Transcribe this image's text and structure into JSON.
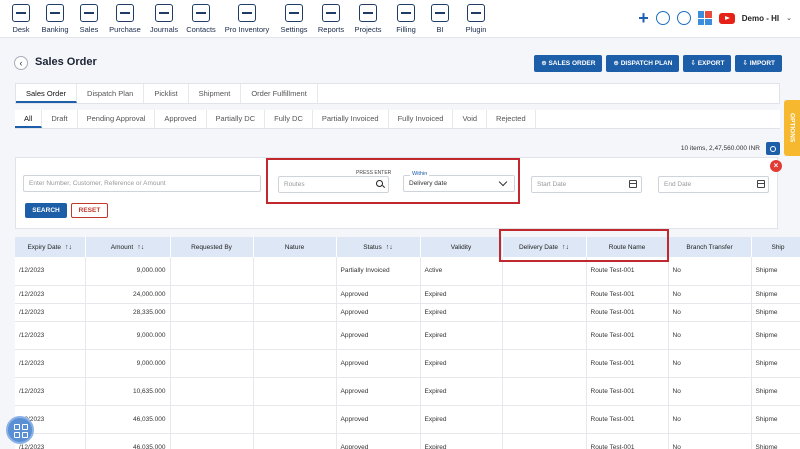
{
  "nav": [
    {
      "label": "Desk",
      "icon": "desk-icon"
    },
    {
      "label": "Banking",
      "icon": "bank-icon"
    },
    {
      "label": "Sales",
      "icon": "sales-icon"
    },
    {
      "label": "Purchase",
      "icon": "purchase-icon"
    },
    {
      "label": "Journals",
      "icon": "journals-icon"
    },
    {
      "label": "Contacts",
      "icon": "contacts-icon"
    },
    {
      "label": "Pro Inventory",
      "icon": "inventory-icon"
    },
    {
      "label": "Settings",
      "icon": "settings-icon"
    },
    {
      "label": "Reports",
      "icon": "reports-icon"
    },
    {
      "label": "Projects",
      "icon": "projects-icon"
    },
    {
      "label": "Filling",
      "icon": "filling-icon"
    },
    {
      "label": "BI",
      "icon": "bi-icon"
    },
    {
      "label": "Plugin",
      "icon": "plugin-icon"
    }
  ],
  "user": {
    "name": "Demo - HI"
  },
  "page": {
    "title": "Sales Order"
  },
  "actions": {
    "sales_order": "SALES ORDER",
    "dispatch_plan": "DISPATCH PLAN",
    "export": "EXPORT",
    "import": "IMPORT"
  },
  "options_label": "OPTIONS",
  "main_tabs": [
    "Sales Order",
    "Dispatch Plan",
    "Picklist",
    "Shipment",
    "Order Fulfillment"
  ],
  "status_tabs": [
    "All",
    "Draft",
    "Pending Approval",
    "Approved",
    "Partially DC",
    "Fully DC",
    "Partially Invoiced",
    "Fully Invoiced",
    "Void",
    "Rejected"
  ],
  "summary": "10 items, 2,47,560.000 INR",
  "filters": {
    "search_placeholder": "Enter Number, Customer, Reference or Amount",
    "press_enter": "PRESS ENTER",
    "routes_placeholder": "Routes",
    "within_label": "Within",
    "within_value": "Delivery date",
    "start_date_placeholder": "Start Date",
    "end_date_placeholder": "End Date",
    "search_btn": "SEARCH",
    "reset_btn": "RESET"
  },
  "table": {
    "headers": [
      "Expiry Date",
      "Amount",
      "Requested By",
      "Nature",
      "Status",
      "Validity",
      "Delivery Date",
      "Route Name",
      "Branch Transfer",
      "Ship"
    ],
    "rows": [
      [
        "/12/2023",
        "9,000.000",
        "",
        "",
        "Partially Invoiced",
        "Active",
        "",
        "Route Test-001",
        "No",
        "Shipme"
      ],
      [
        "/12/2023",
        "24,000.000",
        "",
        "",
        "Approved",
        "Expired",
        "",
        "Route Test-001",
        "No",
        "Shipme"
      ],
      [
        "/12/2023",
        "28,335.000",
        "",
        "",
        "Approved",
        "Expired",
        "",
        "Route Test-001",
        "No",
        "Shipme"
      ],
      [
        "/12/2023",
        "9,000.000",
        "",
        "",
        "Approved",
        "Expired",
        "",
        "Route Test-001",
        "No",
        "Shipme"
      ],
      [
        "/12/2023",
        "9,000.000",
        "",
        "",
        "Approved",
        "Expired",
        "",
        "Route Test-001",
        "No",
        "Shipme"
      ],
      [
        "/12/2023",
        "10,635.000",
        "",
        "",
        "Approved",
        "Expired",
        "",
        "Route Test-001",
        "No",
        "Shipme"
      ],
      [
        "/12/2023",
        "46,035.000",
        "",
        "",
        "Approved",
        "Expired",
        "",
        "Route Test-001",
        "No",
        "Shipme"
      ],
      [
        "/12/2023",
        "46,035.000",
        "",
        "",
        "Approved",
        "Expired",
        "",
        "Route Test-001",
        "No",
        "Shipme"
      ]
    ]
  },
  "colors": {
    "primary": "#1d5ea8",
    "highlight": "#c0282d",
    "options": "#f5b82e"
  }
}
